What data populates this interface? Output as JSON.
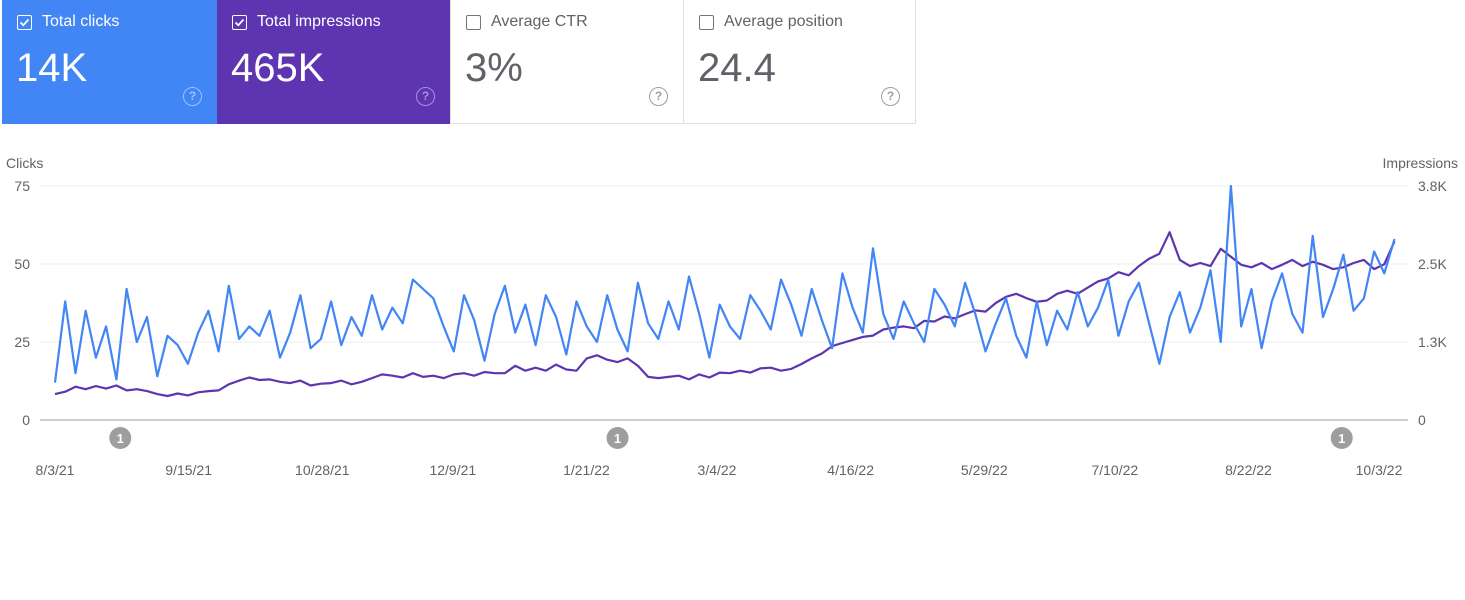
{
  "cards": [
    {
      "label": "Total clicks",
      "value": "14K",
      "checked": true,
      "color": "#4285f4"
    },
    {
      "label": "Total impressions",
      "value": "465K",
      "checked": true,
      "color": "#5e35b1"
    },
    {
      "label": "Average CTR",
      "value": "3%",
      "checked": false
    },
    {
      "label": "Average position",
      "value": "24.4",
      "checked": false
    }
  ],
  "help_icon": "?",
  "chart_data": {
    "type": "line",
    "ylabel_left": "Clicks",
    "ylabel_right": "Impressions",
    "y_left_ticks": [
      "75",
      "50",
      "25",
      "0"
    ],
    "y_left_range": [
      0,
      75
    ],
    "y_right_ticks": [
      "3.8K",
      "2.5K",
      "1.3K",
      "0"
    ],
    "y_right_range": [
      0,
      3800
    ],
    "x_ticks": [
      "8/3/21",
      "9/15/21",
      "10/28/21",
      "12/9/21",
      "1/21/22",
      "3/4/22",
      "4/16/22",
      "5/29/22",
      "7/10/22",
      "8/22/22",
      "10/3/22"
    ],
    "x_start": "8/3/21",
    "x_step_days": 4,
    "annotations": [
      {
        "label": "1",
        "date": "8/24/21"
      },
      {
        "label": "1",
        "date": "1/31/22"
      },
      {
        "label": "1",
        "date": "9/21/22"
      }
    ],
    "grid": true,
    "legend": "none",
    "series": [
      {
        "name": "Clicks",
        "axis": "left",
        "color": "#4285f4",
        "values": [
          12,
          38,
          15,
          35,
          20,
          30,
          13,
          42,
          25,
          33,
          14,
          27,
          24,
          18,
          28,
          35,
          22,
          43,
          26,
          30,
          27,
          35,
          20,
          28,
          40,
          23,
          26,
          38,
          24,
          33,
          27,
          40,
          29,
          36,
          31,
          45,
          42,
          39,
          30,
          22,
          40,
          32,
          19,
          34,
          43,
          28,
          37,
          24,
          40,
          33,
          21,
          38,
          30,
          25,
          40,
          29,
          22,
          44,
          31,
          26,
          38,
          29,
          46,
          34,
          20,
          37,
          30,
          26,
          40,
          35,
          29,
          45,
          37,
          27,
          42,
          32,
          23,
          47,
          36,
          28,
          55,
          34,
          26,
          38,
          31,
          25,
          42,
          37,
          30,
          44,
          34,
          22,
          31,
          39,
          27,
          20,
          38,
          24,
          35,
          29,
          41,
          30,
          36,
          45,
          27,
          38,
          44,
          31,
          18,
          33,
          41,
          28,
          36,
          48,
          25,
          75,
          30,
          42,
          23,
          38,
          47,
          34,
          28,
          59,
          33,
          42,
          53,
          35,
          39,
          54,
          47,
          58
        ]
      },
      {
        "name": "Impressions",
        "axis": "right",
        "color": "#5e35b1",
        "values": [
          420,
          460,
          540,
          500,
          550,
          510,
          560,
          480,
          500,
          470,
          420,
          390,
          430,
          400,
          450,
          470,
          480,
          580,
          640,
          690,
          650,
          660,
          620,
          600,
          640,
          560,
          590,
          600,
          640,
          580,
          620,
          680,
          740,
          720,
          690,
          760,
          700,
          720,
          680,
          740,
          760,
          720,
          780,
          760,
          760,
          880,
          800,
          850,
          800,
          900,
          820,
          800,
          1000,
          1050,
          980,
          940,
          1000,
          880,
          700,
          680,
          700,
          720,
          660,
          740,
          690,
          770,
          760,
          800,
          770,
          840,
          850,
          800,
          830,
          910,
          1000,
          1080,
          1200,
          1250,
          1300,
          1350,
          1370,
          1470,
          1500,
          1520,
          1490,
          1610,
          1600,
          1680,
          1650,
          1720,
          1780,
          1760,
          1900,
          2000,
          2050,
          1980,
          1920,
          1940,
          2050,
          2100,
          2050,
          2150,
          2250,
          2300,
          2400,
          2350,
          2500,
          2620,
          2700,
          3050,
          2600,
          2500,
          2550,
          2500,
          2780,
          2650,
          2520,
          2480,
          2550,
          2450,
          2520,
          2600,
          2500,
          2570,
          2520,
          2450,
          2480,
          2550,
          2600,
          2450,
          2530,
          2900
        ]
      }
    ]
  }
}
